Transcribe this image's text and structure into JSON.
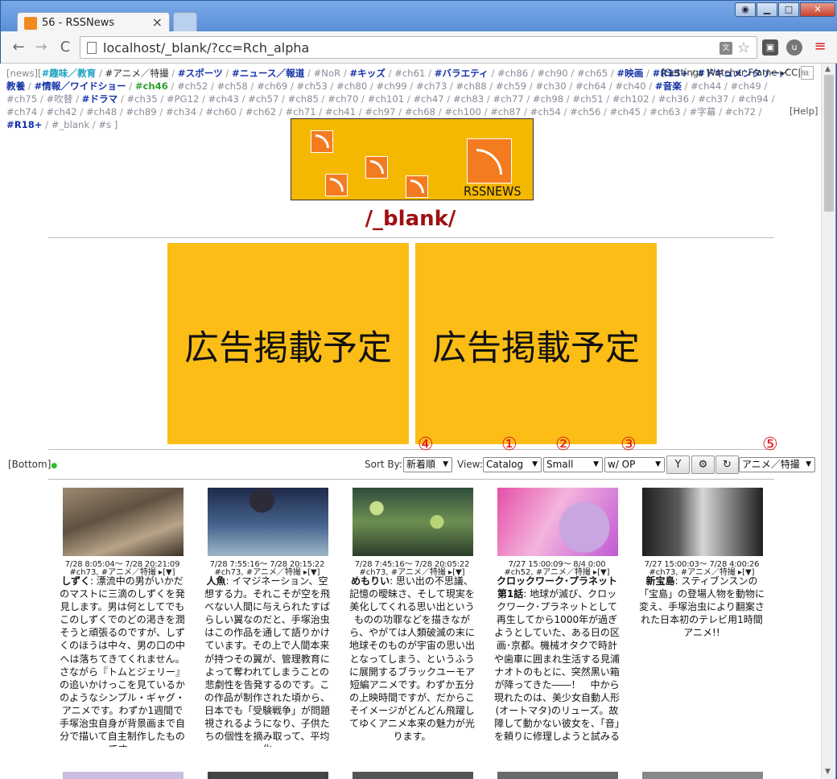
{
  "browser": {
    "tab_title": "56 - RSSNews",
    "url": "localhost/_blank/?cc=Rch_alpha",
    "tab_close": "×",
    "back": "←",
    "forward": "→",
    "reload": "C"
  },
  "nav": {
    "prefix": "[news][",
    "items": [
      {
        "label": "#趣味／教育",
        "style": "cyan"
      },
      {
        "label": "#アニメ／特撮",
        "style": "active"
      },
      {
        "label": "#スポーツ",
        "style": "hi"
      },
      {
        "label": "#ニュース／報道",
        "style": "hi"
      },
      {
        "label": "#NoR",
        "style": "normal"
      },
      {
        "label": "#キッズ",
        "style": "hi"
      },
      {
        "label": "#ch61",
        "style": "normal"
      },
      {
        "label": "#バラエティ",
        "style": "hi"
      },
      {
        "label": "#ch86",
        "style": "normal"
      },
      {
        "label": "#ch90",
        "style": "normal"
      },
      {
        "label": "#ch65",
        "style": "normal"
      },
      {
        "label": "#映画",
        "style": "hi"
      },
      {
        "label": "#R15+",
        "style": "hi"
      },
      {
        "label": "#ドキュメンタリー／教養",
        "style": "hi"
      },
      {
        "label": "#情報／ワイドショー",
        "style": "hi"
      },
      {
        "label": "#ch46",
        "style": "green"
      },
      {
        "label": "#ch52",
        "style": "normal"
      },
      {
        "label": "#ch58",
        "style": "normal"
      },
      {
        "label": "#ch69",
        "style": "normal"
      },
      {
        "label": "#ch53",
        "style": "normal"
      },
      {
        "label": "#ch80",
        "style": "normal"
      },
      {
        "label": "#ch99",
        "style": "normal"
      },
      {
        "label": "#ch73",
        "style": "normal"
      },
      {
        "label": "#ch88",
        "style": "normal"
      },
      {
        "label": "#ch59",
        "style": "normal"
      },
      {
        "label": "#ch30",
        "style": "normal"
      },
      {
        "label": "#ch64",
        "style": "normal"
      },
      {
        "label": "#ch40",
        "style": "normal"
      },
      {
        "label": "#音楽",
        "style": "hi"
      },
      {
        "label": "#ch44",
        "style": "normal"
      },
      {
        "label": "#ch49",
        "style": "normal"
      },
      {
        "label": "#ch75",
        "style": "normal"
      },
      {
        "label": "#吹替",
        "style": "normal"
      },
      {
        "label": "#ドラマ",
        "style": "hi"
      },
      {
        "label": "#ch35",
        "style": "normal"
      },
      {
        "label": "#PG12",
        "style": "normal"
      },
      {
        "label": "#ch43",
        "style": "normal"
      },
      {
        "label": "#ch57",
        "style": "normal"
      },
      {
        "label": "#ch85",
        "style": "normal"
      },
      {
        "label": "#ch70",
        "style": "normal"
      },
      {
        "label": "#ch101",
        "style": "normal"
      },
      {
        "label": "#ch47",
        "style": "normal"
      },
      {
        "label": "#ch83",
        "style": "normal"
      },
      {
        "label": "#ch77",
        "style": "normal"
      },
      {
        "label": "#ch98",
        "style": "normal"
      },
      {
        "label": "#ch51",
        "style": "normal"
      },
      {
        "label": "#ch102",
        "style": "normal"
      },
      {
        "label": "#ch36",
        "style": "normal"
      },
      {
        "label": "#ch37",
        "style": "normal"
      },
      {
        "label": "#ch94",
        "style": "normal"
      },
      {
        "label": "#ch74",
        "style": "normal"
      },
      {
        "label": "#ch42",
        "style": "normal"
      },
      {
        "label": "#ch48",
        "style": "normal"
      },
      {
        "label": "#ch89",
        "style": "normal"
      },
      {
        "label": "#ch34",
        "style": "normal"
      },
      {
        "label": "#ch60",
        "style": "normal"
      },
      {
        "label": "#ch62",
        "style": "normal"
      },
      {
        "label": "#ch71",
        "style": "normal"
      },
      {
        "label": "#ch41",
        "style": "normal"
      },
      {
        "label": "#ch97",
        "style": "normal"
      },
      {
        "label": "#ch68",
        "style": "normal"
      },
      {
        "label": "#ch100",
        "style": "normal"
      },
      {
        "label": "#ch87",
        "style": "normal"
      },
      {
        "label": "#ch54",
        "style": "normal"
      },
      {
        "label": "#ch56",
        "style": "normal"
      },
      {
        "label": "#ch45",
        "style": "normal"
      },
      {
        "label": "#ch63",
        "style": "normal"
      },
      {
        "label": "#字幕",
        "style": "normal"
      },
      {
        "label": "#ch72",
        "style": "normal"
      },
      {
        "label": "#R18+",
        "style": "hi"
      },
      {
        "label": "#_blank",
        "style": "normal"
      },
      {
        "label": "#s",
        "style": "normal"
      }
    ],
    "suffix": "]",
    "settings_links": "[Settings Watcher Frame ▸CC|◂",
    "filter_placeholder": "filt",
    "help": "[Help]"
  },
  "logo": {
    "text": "RSSNEWS"
  },
  "page": {
    "heading": "/_blank/"
  },
  "ads": [
    "広告掲載予定",
    "広告掲載予定"
  ],
  "controls": {
    "bottom_link": "[Bottom]",
    "bottom_dot": "●",
    "sort_label": "Sort By:",
    "sort_value": "新着順",
    "view_label": "View:",
    "view_value": "Catalog",
    "size_value": "Small",
    "op_value": "w/ OP",
    "genre_value": "アニメ／特撮",
    "filter_btn": "Y",
    "gear_btn": "⚙",
    "refresh_btn": "↻",
    "markers": {
      "m1": "①",
      "m2": "②",
      "m3": "③",
      "m4": "④",
      "m5": "⑤"
    }
  },
  "cards": [
    {
      "date": "7/28 8:05:04～ 7/28 20:21:09",
      "tags": "#ch73, #アニメ／特撮 ▸[▼]",
      "title": "しずく",
      "body": ": 漂流中の男がいかだのマストに三滴のしずくを発見します。男は何としてでもこのしずくでのどの渇きを潤そうと頑張るのですが、しずくのほうは中々、男の口の中へは落ちてきてくれません。さながら『トムとジェリー』の追いかけっこを見ているかのようなシンプル・ギャグ・アニメです。わずか1週間で手塚治虫自身が背景画まで自分で描いて自主制作したものです。"
    },
    {
      "date": "7/28 7:55:16～ 7/28 20:15:22",
      "tags": "#ch73, #アニメ／特撮 ▸[▼]",
      "title": "人魚",
      "body": ": イマジネーション、空想する力。それこそが空を飛べない人間に与えられたすばらしい翼なのだと、手塚治虫はこの作品を通して語りかけています。その上で人間本来が持つその翼が、管理教育によって奪われてしまうことの悲劇性を告発するのです。この作品が制作された頃から、日本でも「受験戦争」が問題視されるようになり、子供たちの個性を摘み取って、平均化"
    },
    {
      "date": "7/28 7:45:16～ 7/28 20:05:22",
      "tags": "#ch73, #アニメ／特撮 ▸[▼]",
      "title": "めもりい",
      "body": ": 思い出の不思議、記憶の曖昧さ、そして現実を美化してくれる思い出というものの功罪などを描きながら、やがては人類破滅の末に地球そのものが宇宙の思い出となってしまう、というふうに展開するブラックユーモア短編アニメです。わずか五分の上映時間ですが、だからこそイメージがどんどん飛躍してゆくアニメ本来の魅力が光ります。"
    },
    {
      "date": "7/27 15:00:09～ 8/4 0:00",
      "tags": "#ch52, #アニメ／特撮 ▸[▼]",
      "title": "クロックワーク･プラネット 第1話",
      "body": ": 地球が滅び、クロックワーク･プラネットとして再生してから1000年が過ぎようとしていた、ある日の区画･京都。機械オタクで時計や歯車に囲まれ生活する見浦ナオトのもとに、突然黒い箱が降ってきた――！　中から現れたのは、美少女自動人形(オートマタ)のリューズ。故障して動かない彼女を、「音」を頼りに修理しようと試みる"
    },
    {
      "date": "7/27 15:00:03～ 7/28 4:00:26",
      "tags": "#ch73, #アニメ／特撮 ▸[▼]",
      "title": "新宝島",
      "body": ": スティブンスンの「宝島」の登場人物を動物に変え、手塚治虫により翻案された日本初のテレビ用1時間アニメ!!"
    }
  ]
}
